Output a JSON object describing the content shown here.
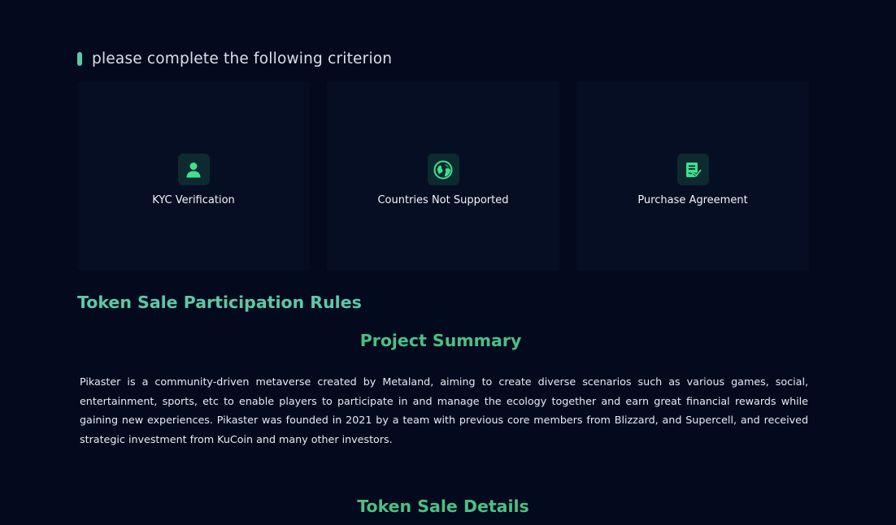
{
  "criterion": {
    "title": "please complete the following criterion",
    "accent_color": "#5cc9a7"
  },
  "cards": [
    {
      "label": "KYC Verification",
      "icon": "user-icon"
    },
    {
      "label": "Countries Not Supported",
      "icon": "globe-icon"
    },
    {
      "label": "Purchase Agreement",
      "icon": "agreement-doc-icon"
    }
  ],
  "rules": {
    "title": "Token Sale Participation Rules"
  },
  "summary": {
    "title": "Project Summary",
    "text": "Pikaster is a community-driven metaverse created by Metaland, aiming to create diverse scenarios such as various games, social, entertainment, sports, etc to enable players to participate in and manage the ecology together and earn great financial rewards while gaining new experiences. Pikaster was founded in 2021 by a team with previous core members from Blizzard, and Supercell, and received strategic investment from KuCoin and many other investors."
  },
  "details": {
    "title": "Token Sale Details"
  },
  "colors": {
    "background": "#040a1d",
    "card_bg": "#060e24",
    "icon_bg": "#0c2a30",
    "icon_fg": "#3fe08f",
    "heading_green": "#4cbf86"
  }
}
